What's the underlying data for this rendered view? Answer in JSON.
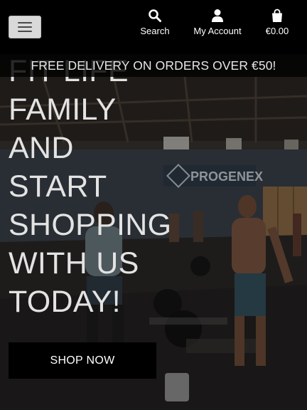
{
  "header": {
    "menu_icon": "hamburger-icon",
    "nav": [
      {
        "label": "Search",
        "icon": "search-icon"
      },
      {
        "label": "My Account",
        "icon": "user-icon"
      },
      {
        "label": "€0.00",
        "icon": "shopping-bag-icon"
      }
    ]
  },
  "banner": {
    "text": "FREE DELIVERY ON ORDERS OVER €50!"
  },
  "hero": {
    "title_lines": [
      "FIT LIFE",
      "FAMILY",
      "AND",
      "START",
      "SHOPPING",
      "WITH US",
      "TODAY!"
    ],
    "background_sign": "PROGENEX",
    "cta_label": "SHOP NOW"
  },
  "colors": {
    "header_bg": "#000000",
    "menu_button_bg": "#d9d9d9",
    "title_text": "#e3e3e3",
    "cta_bg": "#000000"
  }
}
